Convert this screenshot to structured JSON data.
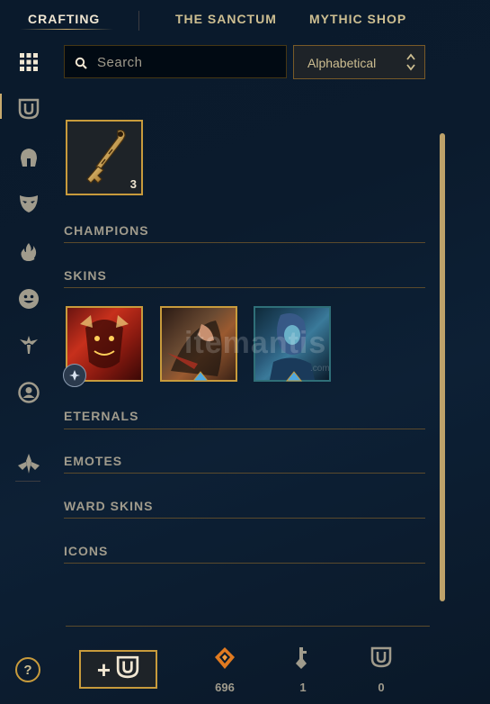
{
  "nav": {
    "tabs": [
      {
        "label": "CRAFTING"
      },
      {
        "label": "THE SANCTUM"
      },
      {
        "label": "MYTHIC SHOP"
      }
    ]
  },
  "sidebar": {
    "items": [
      {
        "icon": "grid-icon",
        "active": true
      },
      {
        "icon": "chest-icon"
      },
      {
        "icon": "helmet-icon"
      },
      {
        "icon": "mask-icon"
      },
      {
        "icon": "flame-icon"
      },
      {
        "icon": "emote-face-icon"
      },
      {
        "icon": "ward-icon"
      },
      {
        "icon": "profile-icon"
      },
      {
        "icon": "eternals-icon"
      }
    ]
  },
  "search": {
    "placeholder": "Search"
  },
  "sort": {
    "value": "Alphabetical"
  },
  "key_item": {
    "count": "3"
  },
  "sections": {
    "champions": "CHAMPIONS",
    "skins": "SKINS",
    "eternals": "ETERNALS",
    "emotes": "EMOTES",
    "ward_skins": "WARD SKINS",
    "icons": "ICONS"
  },
  "watermark": {
    "text": "itemantis",
    "sub": ".com"
  },
  "footer": {
    "help": "?",
    "currencies": [
      {
        "icon": "orange-essence-icon",
        "value": "696"
      },
      {
        "icon": "key-fragment-icon",
        "value": "1"
      },
      {
        "icon": "chest-icon",
        "value": "0"
      }
    ]
  },
  "colors": {
    "gold": "#c8aa6e",
    "gold_border": "#c89b3c",
    "background": "#0a1a2c",
    "text": "#a09b8c"
  }
}
